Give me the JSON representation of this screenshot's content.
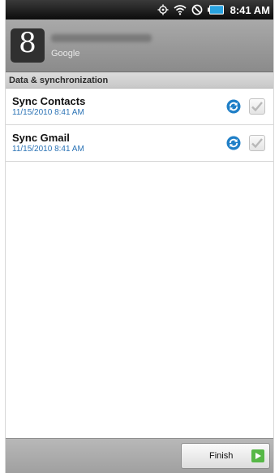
{
  "status_bar": {
    "time": "8:41 AM",
    "icons": [
      "gps-icon",
      "wifi-icon",
      "no-signal-icon",
      "battery-icon"
    ]
  },
  "account": {
    "logo_letter": "8",
    "type": "Google"
  },
  "section": {
    "title": "Data & synchronization"
  },
  "sync_items": [
    {
      "title": "Sync Contacts",
      "time": "11/15/2010 8:41 AM",
      "checked": true
    },
    {
      "title": "Sync Gmail",
      "time": "11/15/2010 8:41 AM",
      "checked": true
    }
  ],
  "footer": {
    "finish_label": "Finish"
  },
  "colors": {
    "accent_blue": "#2a72b5",
    "finish_green": "#57b847"
  }
}
